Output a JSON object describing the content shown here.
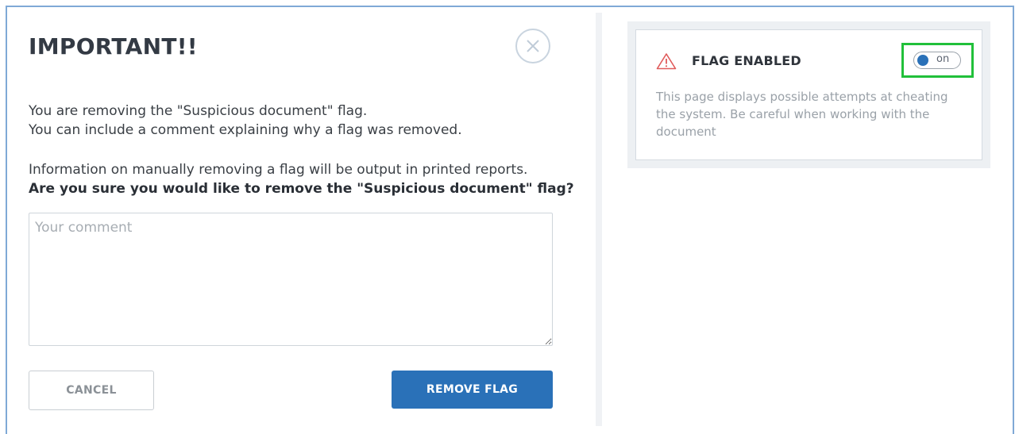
{
  "modal": {
    "title": "IMPORTANT!!",
    "line1": "You are removing the \"Suspicious document\" flag.",
    "line2": "You can include a comment explaining why a flag was removed.",
    "line3": "Information on manually removing a flag will be output in printed reports.",
    "line4": "Are you sure you would like to remove the \"Suspicious document\" flag?",
    "comment_placeholder": "Your comment",
    "cancel_label": "CANCEL",
    "remove_label": "REMOVE FLAG"
  },
  "flag_panel": {
    "title": "FLAG ENABLED",
    "toggle_label": "on",
    "description": "This page displays possible attempts at cheating the system. Be careful when working with the document"
  },
  "colors": {
    "accent": "#2a71b8",
    "highlight": "#21c03a",
    "warning": "#e05a5a"
  }
}
